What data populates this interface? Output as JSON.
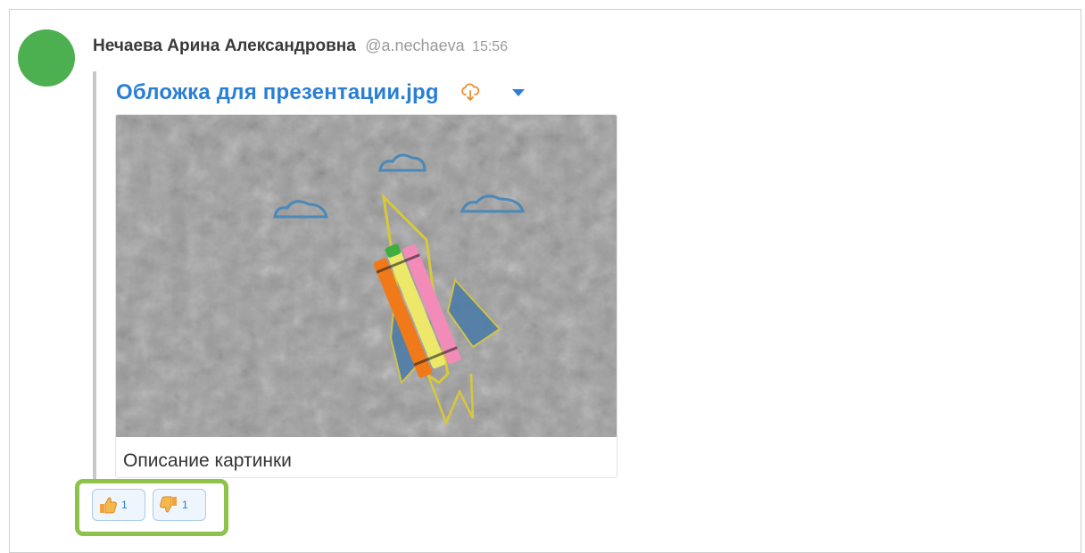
{
  "message": {
    "author": "Нечаева Арина Александровна",
    "handle": "@a.nechaeva",
    "time": "15:56",
    "avatar_color": "#4caf50"
  },
  "attachment": {
    "file_name": "Обложка для презентации.jpg",
    "caption": "Описание картинки",
    "link_color": "#2a7fd4",
    "download_icon": "cloud-download-icon",
    "menu_icon": "caret-down-icon"
  },
  "reactions": [
    {
      "icon": "thumbs-up-icon",
      "count": "1"
    },
    {
      "icon": "thumbs-down-icon",
      "count": "1"
    }
  ],
  "highlight_color": "#8fc24a"
}
